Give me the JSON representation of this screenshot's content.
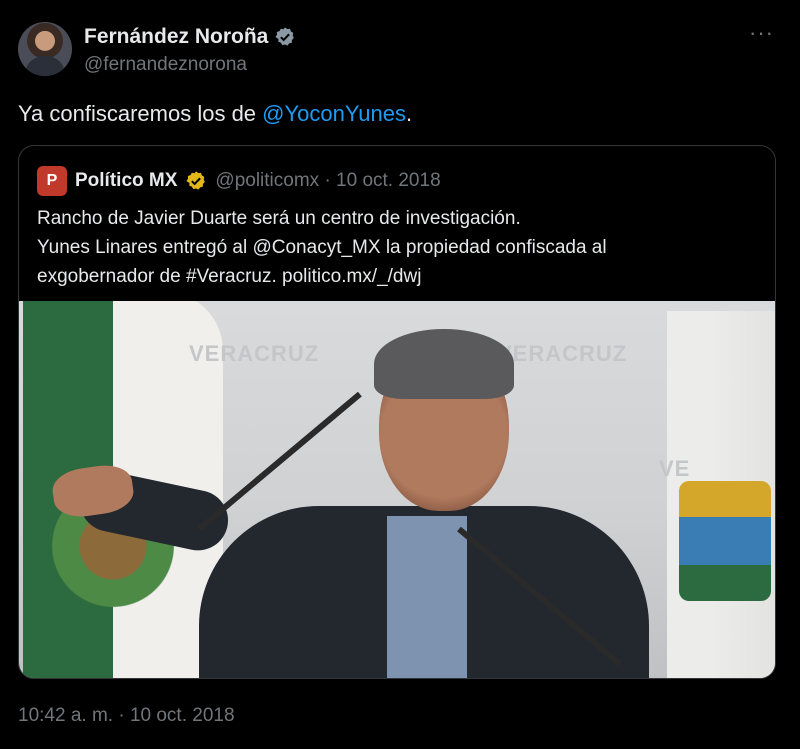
{
  "author": {
    "name": "Fernández Noroña",
    "handle": "@fernandeznorona"
  },
  "menu": {
    "more_label": "···"
  },
  "tweet": {
    "text_prefix": "Ya confiscaremos los de ",
    "mention": "@YoconYunes",
    "text_suffix": "."
  },
  "quoted": {
    "logo_letter": "P",
    "name": "Político MX",
    "meta": "@politicomx · 10 oct. 2018",
    "lines": [
      "Rancho de Javier Duarte será un centro de investigación.",
      "Yunes Linares entregó al @Conacyt_MX la propiedad confiscada al",
      "exgobernador de #Veracruz. politico.mx/_/dwj"
    ],
    "photo_watermarks": [
      "VERACRUZ",
      "VERACRUZ",
      "VE"
    ]
  },
  "timestamp": "10:42 a. m. · 10 oct. 2018",
  "colors": {
    "background": "#000000",
    "text": "#e7e9ea",
    "muted": "#71767b",
    "link": "#1d9bf0",
    "verified_blue": "#8b98a5",
    "verified_gold": "#e2b719"
  }
}
